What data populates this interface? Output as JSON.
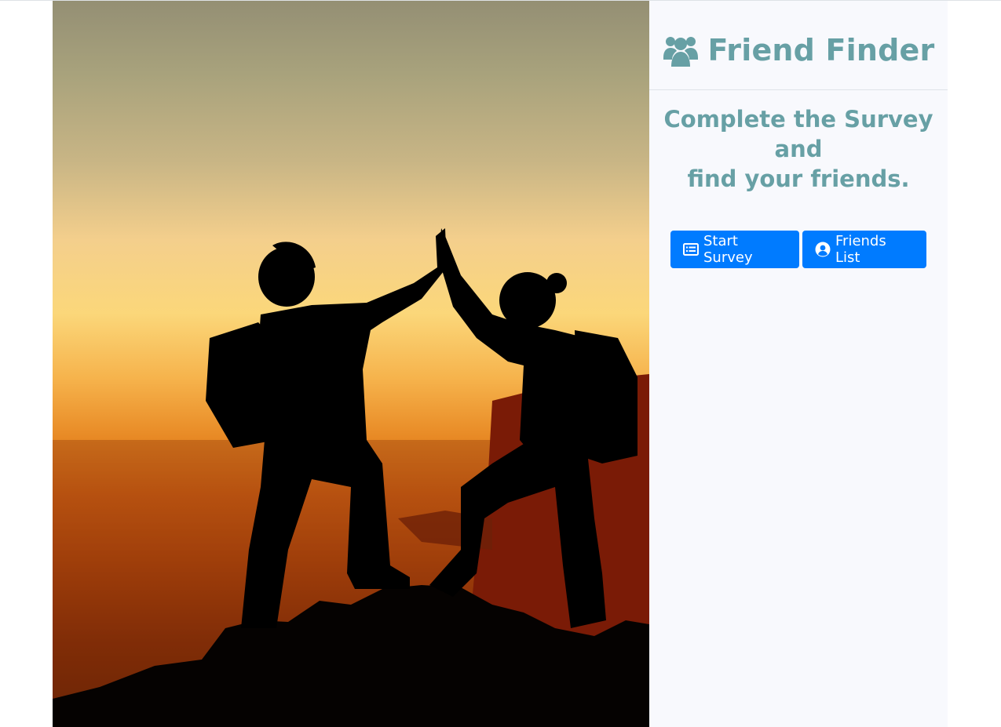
{
  "brand": {
    "title": "Friend Finder",
    "icon": "users-icon",
    "color": "#67a0a5"
  },
  "hero": {
    "icon": "hikers-high-five-sunset-photo"
  },
  "main": {
    "tagline_line1": "Complete the Survey and",
    "tagline_line2": "find your friends."
  },
  "actions": {
    "start_survey_label": "Start Survey",
    "start_survey_icon": "survey-list-icon",
    "friends_list_label": "Friends List",
    "friends_list_icon": "user-circle-icon",
    "button_color": "#007bff"
  }
}
